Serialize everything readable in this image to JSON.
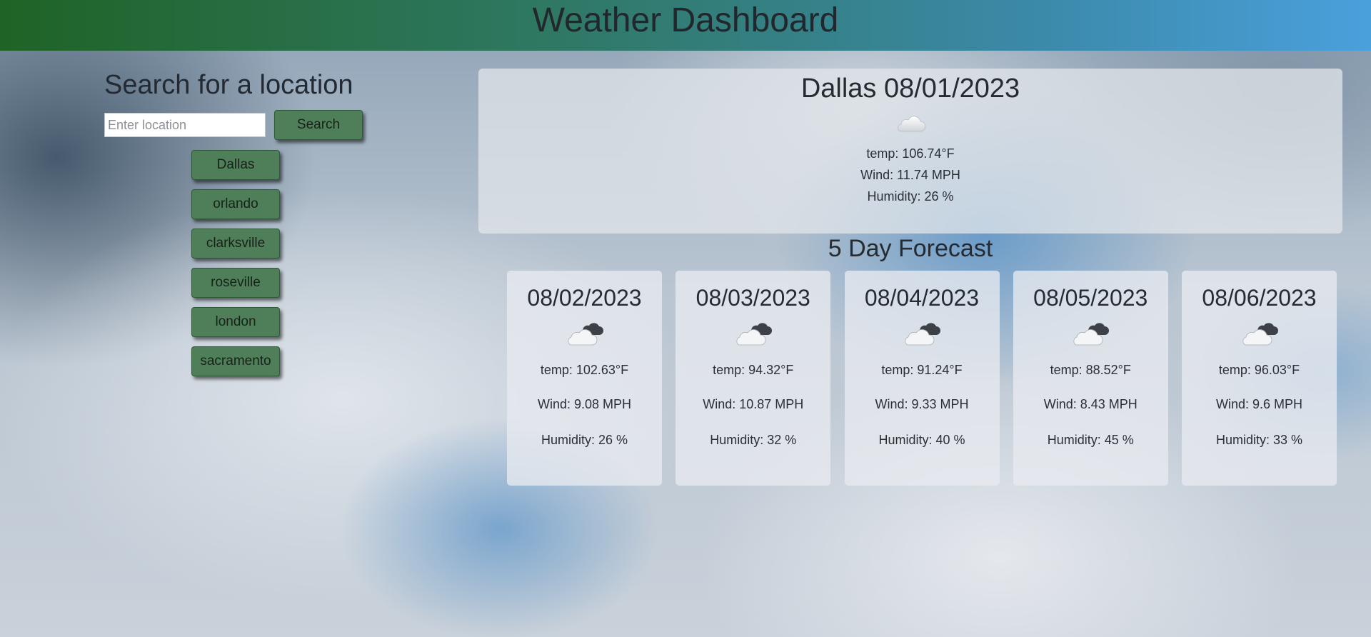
{
  "header": {
    "title": "Weather Dashboard"
  },
  "search": {
    "heading": "Search for a location",
    "placeholder": "Enter location",
    "button_label": "Search"
  },
  "history": [
    "Dallas",
    "orlando",
    "clarksville",
    "roseville",
    "london",
    "sacramento"
  ],
  "current": {
    "title": "Dallas 08/01/2023",
    "icon": "cloud-icon",
    "temp": "temp: 106.74°F",
    "wind": "Wind: 11.74 MPH",
    "humidity": "Humidity: 26 %"
  },
  "forecast_title": "5 Day Forecast",
  "forecast": [
    {
      "date": "08/02/2023",
      "icon": "cloudy-icon",
      "temp": "temp: 102.63°F",
      "wind": "Wind: 9.08 MPH",
      "humidity": "Humidity: 26 %"
    },
    {
      "date": "08/03/2023",
      "icon": "cloudy-icon",
      "temp": "temp: 94.32°F",
      "wind": "Wind: 10.87 MPH",
      "humidity": "Humidity: 32 %"
    },
    {
      "date": "08/04/2023",
      "icon": "cloudy-icon",
      "temp": "temp: 91.24°F",
      "wind": "Wind: 9.33 MPH",
      "humidity": "Humidity: 40 %"
    },
    {
      "date": "08/05/2023",
      "icon": "cloudy-icon",
      "temp": "temp: 88.52°F",
      "wind": "Wind: 8.43 MPH",
      "humidity": "Humidity: 45 %"
    },
    {
      "date": "08/06/2023",
      "icon": "cloudy-icon",
      "temp": "temp: 96.03°F",
      "wind": "Wind: 9.6 MPH",
      "humidity": "Humidity: 33 %"
    }
  ],
  "colors": {
    "header_start": "#1f6326",
    "header_end": "#4aa0dc",
    "button": "#4e7f58"
  }
}
